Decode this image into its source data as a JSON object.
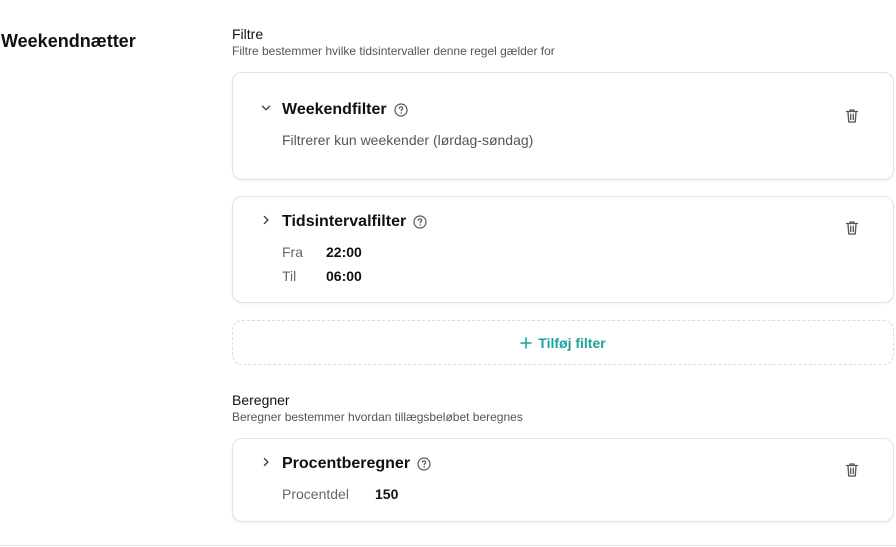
{
  "rule": {
    "title": "Weekendnætter"
  },
  "filters": {
    "title": "Filtre",
    "subtitle": "Filtre bestemmer hvilke tidsintervaller denne regel gælder for",
    "items": [
      {
        "title": "Weekendfilter",
        "expanded": true,
        "description": "Filtrerer kun weekender (lørdag-søndag)"
      },
      {
        "title": "Tidsintervalfilter",
        "expanded": false,
        "fields": [
          {
            "label": "Fra",
            "value": "22:00"
          },
          {
            "label": "Til",
            "value": "06:00"
          }
        ]
      }
    ],
    "add_label": "Tilføj filter"
  },
  "calculator": {
    "title": "Beregner",
    "subtitle": "Beregner bestemmer hvordan tillægsbeløbet beregnes",
    "item": {
      "title": "Procentberegner",
      "expanded": false,
      "fields": [
        {
          "label": "Procentdel",
          "value": "150"
        }
      ]
    }
  },
  "colors": {
    "accent": "#1aa39a",
    "border": "#e2e2e2",
    "muted": "#555555"
  },
  "icons": {
    "expanded": "chevron-down-icon",
    "collapsed": "chevron-right-icon",
    "help": "help-circle-icon",
    "delete": "trash-icon",
    "add": "plus-icon"
  }
}
